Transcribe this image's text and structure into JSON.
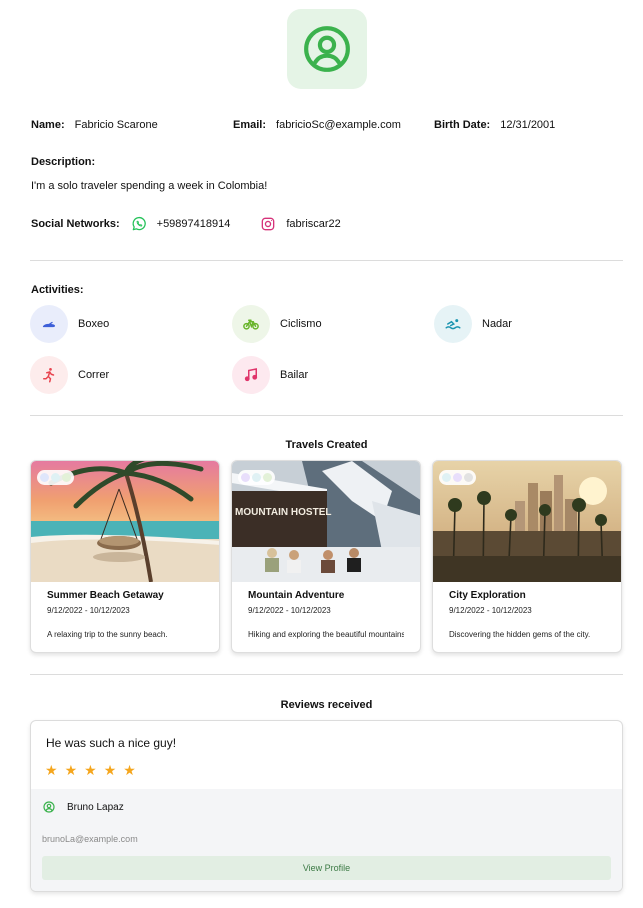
{
  "profile": {
    "name_label": "Name:",
    "name": "Fabricio Scarone",
    "email_label": "Email:",
    "email": "fabricioSc@example.com",
    "birth_label": "Birth Date:",
    "birth_date": "12/31/2001",
    "description_label": "Description:",
    "description": "I'm a solo traveler spending a week in Colombia!",
    "social_label": "Social Networks:",
    "whatsapp": "+59897418914",
    "instagram": "fabriscar22",
    "avatar_icon": "user-circle-icon",
    "accent_color": "#3bb24d"
  },
  "activities": {
    "label": "Activities:",
    "items": [
      {
        "label": "Boxeo",
        "icon": "boxing-glove-icon",
        "color": "#3d5fd8",
        "bg": "#e9edfb"
      },
      {
        "label": "Ciclismo",
        "icon": "bicycle-icon",
        "color": "#69b52c",
        "bg": "#eef6e8"
      },
      {
        "label": "Nadar",
        "icon": "swimmer-icon",
        "color": "#1a94b0",
        "bg": "#e6f3f6"
      },
      {
        "label": "Correr",
        "icon": "runner-icon",
        "color": "#e8444f",
        "bg": "#fdecec"
      },
      {
        "label": "Bailar",
        "icon": "music-note-icon",
        "color": "#e0356b",
        "bg": "#fde9ef"
      }
    ]
  },
  "travels": {
    "title": "Travels Created",
    "items": [
      {
        "title": "Summer Beach Getaway",
        "dates": "9/12/2022 - 10/12/2023",
        "description": "A relaxing trip to the sunny beach."
      },
      {
        "title": "Mountain Adventure",
        "dates": "9/12/2022 - 10/12/2023",
        "description": "Hiking and exploring the beautiful mountains.",
        "sign": "MOUNTAIN HOSTEL"
      },
      {
        "title": "City Exploration",
        "dates": "9/12/2022 - 10/12/2023",
        "description": "Discovering the hidden gems of the city."
      }
    ]
  },
  "reviews": {
    "title": "Reviews received",
    "items": [
      {
        "text": "He was such a nice guy!",
        "rating": 5,
        "reviewer": "Bruno Lapaz",
        "email": "brunoLa@example.com",
        "button": "View Profile"
      }
    ]
  }
}
